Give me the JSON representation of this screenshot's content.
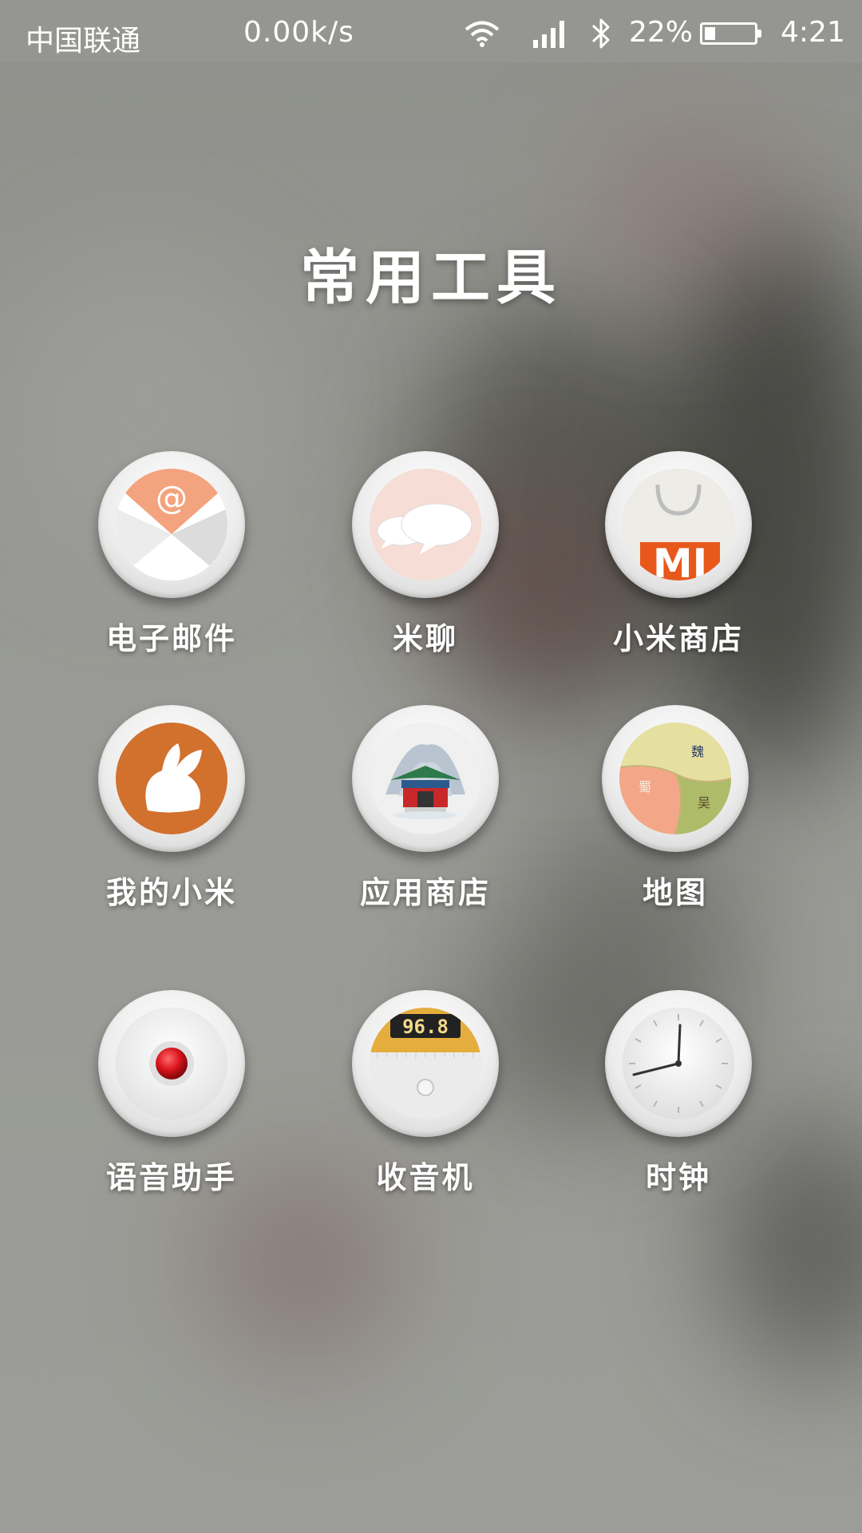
{
  "status_bar": {
    "carrier": "中国联通",
    "network_speed": "0.00k/s",
    "battery_percent": "22%",
    "battery_level": 0.22,
    "time": "4:21",
    "icons": [
      "wifi-icon",
      "signal-icon",
      "bluetooth-icon",
      "battery-icon"
    ]
  },
  "folder": {
    "title": "常用工具"
  },
  "apps": [
    {
      "label": "电子邮件",
      "icon": "email-icon"
    },
    {
      "label": "米聊",
      "icon": "chat-bubbles-icon"
    },
    {
      "label": "小米商店",
      "icon": "shopping-bag-icon"
    },
    {
      "label": "我的小米",
      "icon": "rabbit-icon"
    },
    {
      "label": "应用商店",
      "icon": "pavilion-icon"
    },
    {
      "label": "地图",
      "icon": "map-icon"
    },
    {
      "label": "语音助手",
      "icon": "record-button-icon"
    },
    {
      "label": "收音机",
      "icon": "radio-icon"
    },
    {
      "label": "时钟",
      "icon": "clock-icon"
    }
  ],
  "map_regions": [
    "魏",
    "蜀",
    "吴"
  ],
  "radio_frequency": "96.8",
  "store_logo_text": "MI",
  "email_symbol": "@",
  "colors": {
    "email_accent": "#f4a37f",
    "chat_bg": "#f6ddd5",
    "mi_orange": "#e8581b",
    "rabbit_bg": "#d2702e",
    "record_red": "#d8141c",
    "radio_gold": "#e4ad3e",
    "map_yellow": "#e6e0a0",
    "map_salmon": "#f4a788",
    "map_green": "#aebc6a"
  }
}
